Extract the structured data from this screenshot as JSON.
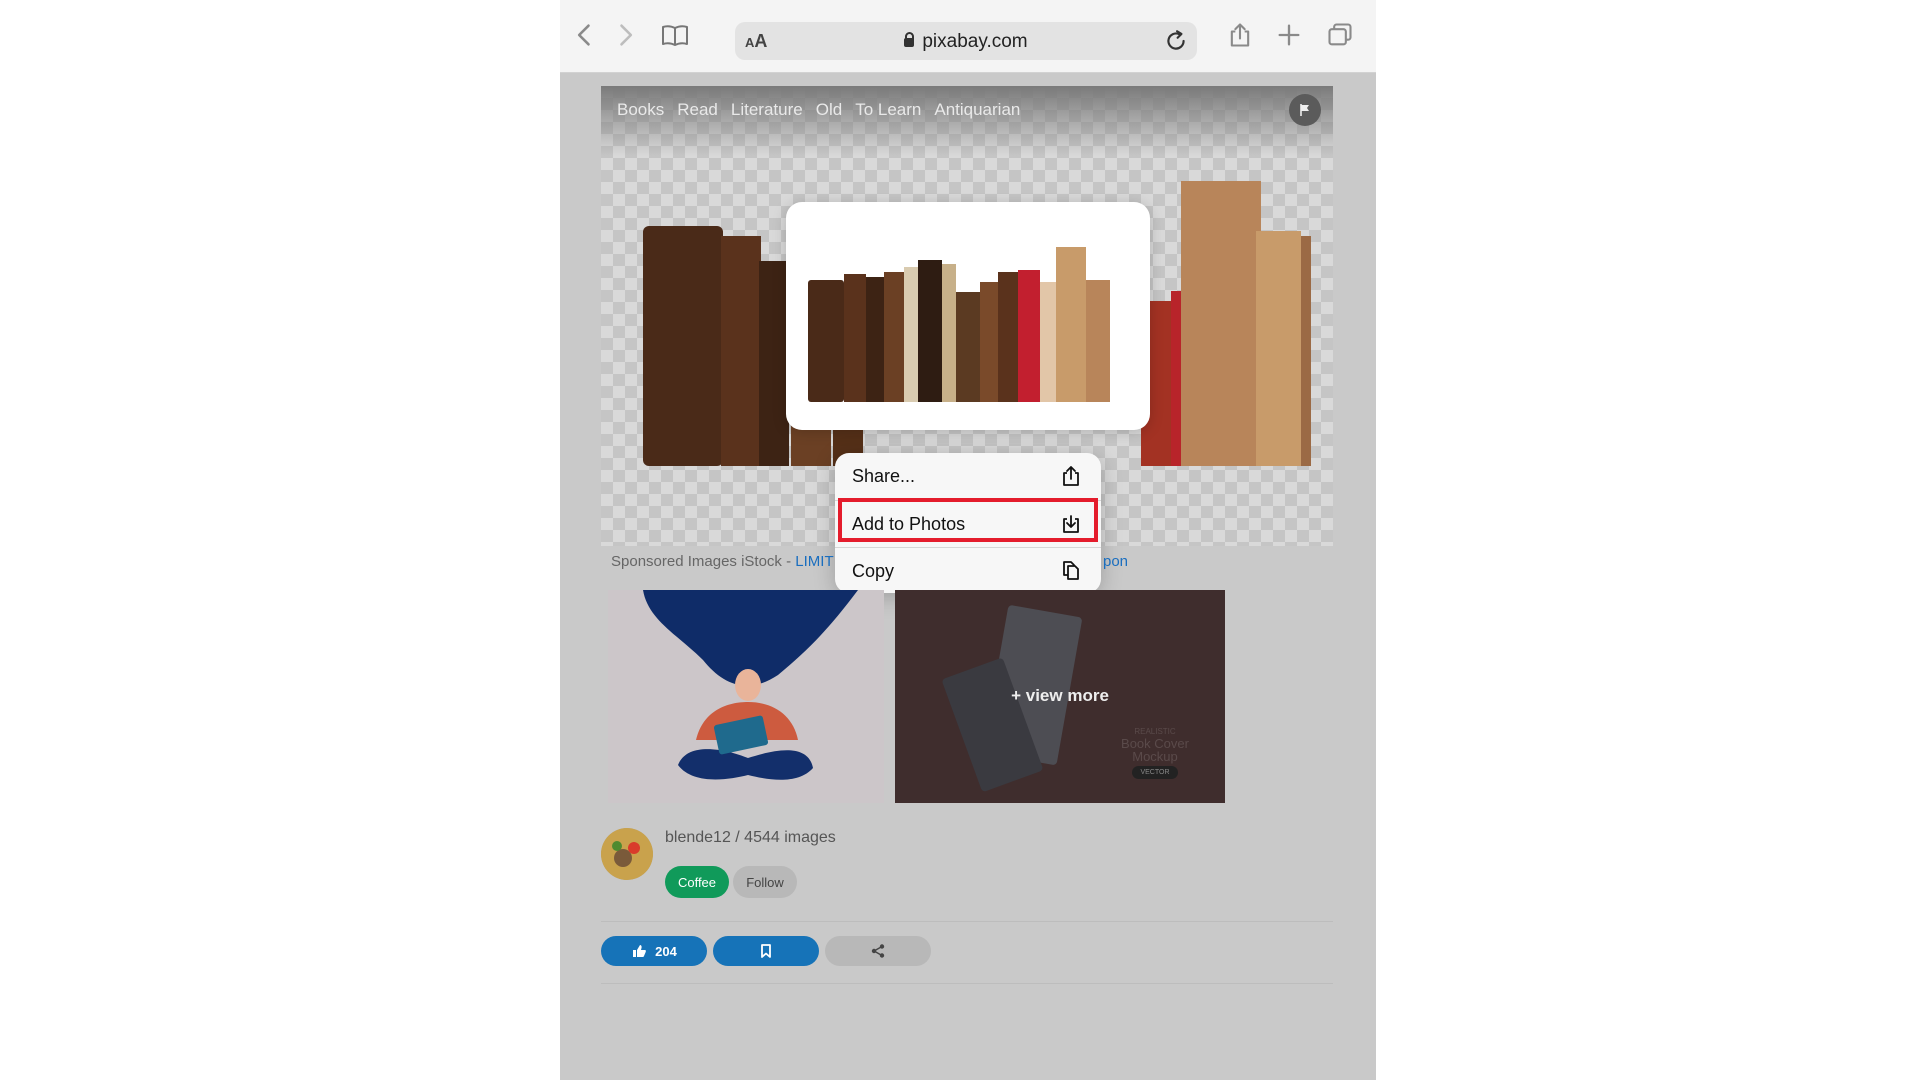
{
  "browser": {
    "aa_label_small": "A",
    "aa_label_large": "A",
    "url": "pixabay.com"
  },
  "hero": {
    "tags": [
      "Books",
      "Read",
      "Literature",
      "Old",
      "To Learn",
      "Antiquarian"
    ]
  },
  "context_menu": {
    "items": [
      {
        "label": "Share...",
        "icon": "share-icon"
      },
      {
        "label": "Add to Photos",
        "icon": "save-to-photos-icon"
      },
      {
        "label": "Copy",
        "icon": "copy-icon"
      }
    ],
    "highlighted_item": "Add to Photos",
    "highlight_color": "#e41c2c"
  },
  "sponsored": {
    "prefix": "Sponsored Images iStock - ",
    "link_visible": "LIMIT",
    "link_tail_visible": "pon"
  },
  "sponsored_images": {
    "view_more_label": "+ view more",
    "mockup_caption": [
      "REALISTIC",
      "Book Cover",
      "Mockup",
      "VECTOR"
    ]
  },
  "author": {
    "name_line": "blende12 / 4544 images",
    "coffee_label": "Coffee",
    "follow_label": "Follow"
  },
  "actions": {
    "like_count": "204"
  },
  "colors": {
    "accent_blue": "#1673b8",
    "coffee_green": "#109a5a",
    "overlay_gray": "#c9c9c9"
  }
}
